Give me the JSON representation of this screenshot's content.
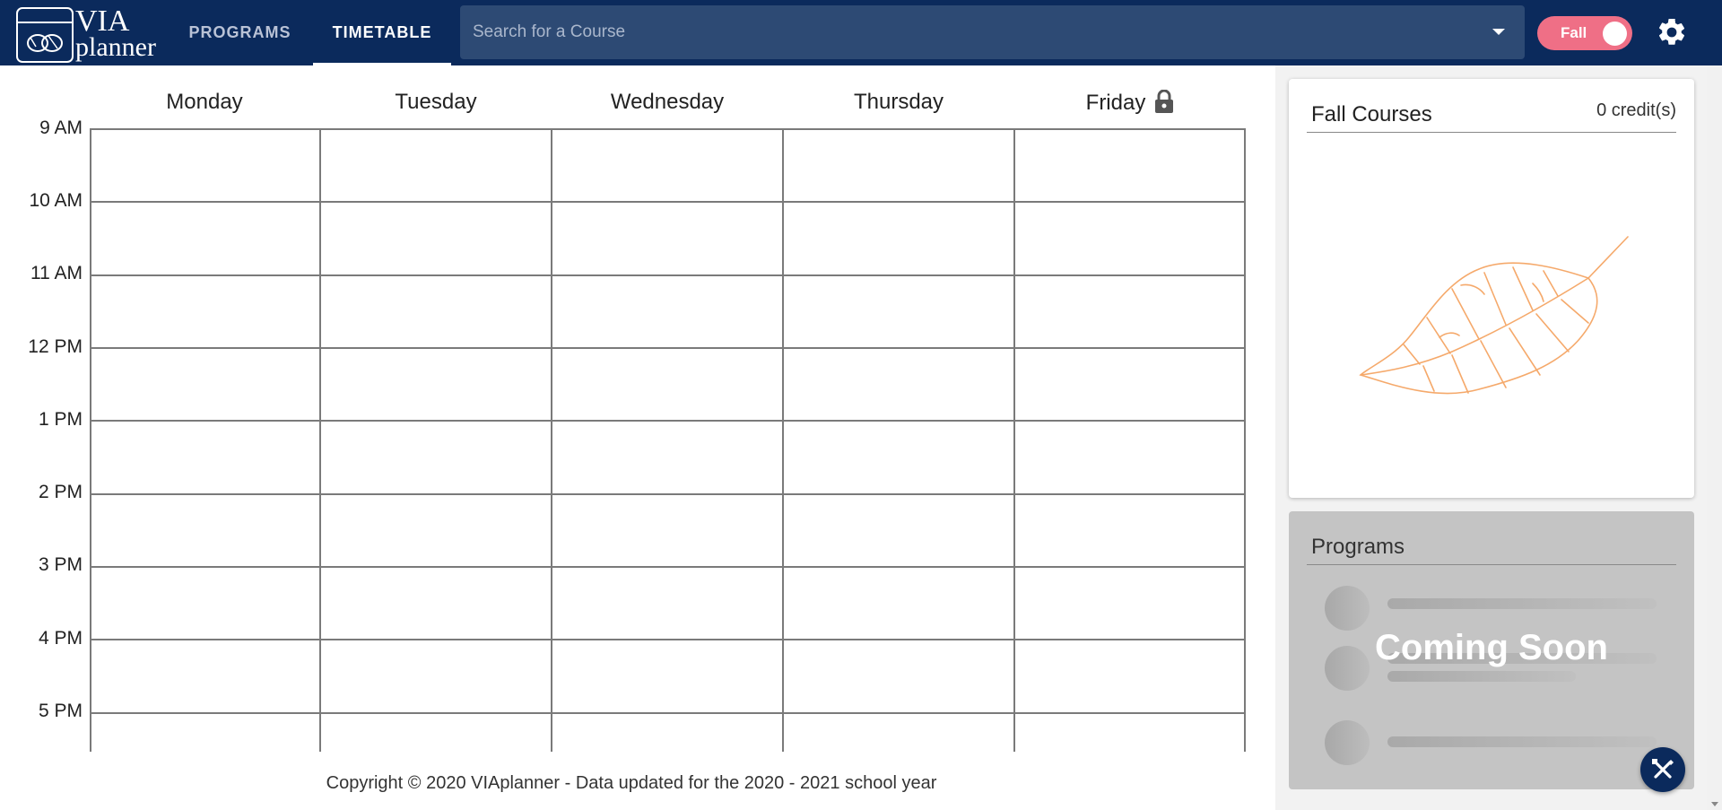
{
  "header": {
    "logo_line1": "VIA",
    "logo_line2": "planner",
    "nav": [
      {
        "label": "PROGRAMS",
        "active": false
      },
      {
        "label": "TIMETABLE",
        "active": true
      }
    ],
    "search_placeholder": "Search for a Course",
    "season": "Fall",
    "colors": {
      "bar": "#0b2a5c",
      "search": "#2d4a74",
      "toggle": "#ef6f86"
    }
  },
  "timetable": {
    "days": [
      "Monday",
      "Tuesday",
      "Wednesday",
      "Thursday",
      "Friday"
    ],
    "locked_day": "Friday",
    "times": [
      "9 AM",
      "10 AM",
      "11 AM",
      "12 PM",
      "1 PM",
      "2 PM",
      "3 PM",
      "4 PM",
      "5 PM"
    ]
  },
  "fall_courses": {
    "title": "Fall Courses",
    "credits": "0 credit(s)",
    "illustration": "leaf-illustration",
    "accent": "#f5a96b"
  },
  "programs": {
    "title": "Programs",
    "overlay": "Coming Soon"
  },
  "footer": {
    "text": "Copyright © 2020 VIAplanner - Data updated for the 2020 - 2021 school year"
  }
}
